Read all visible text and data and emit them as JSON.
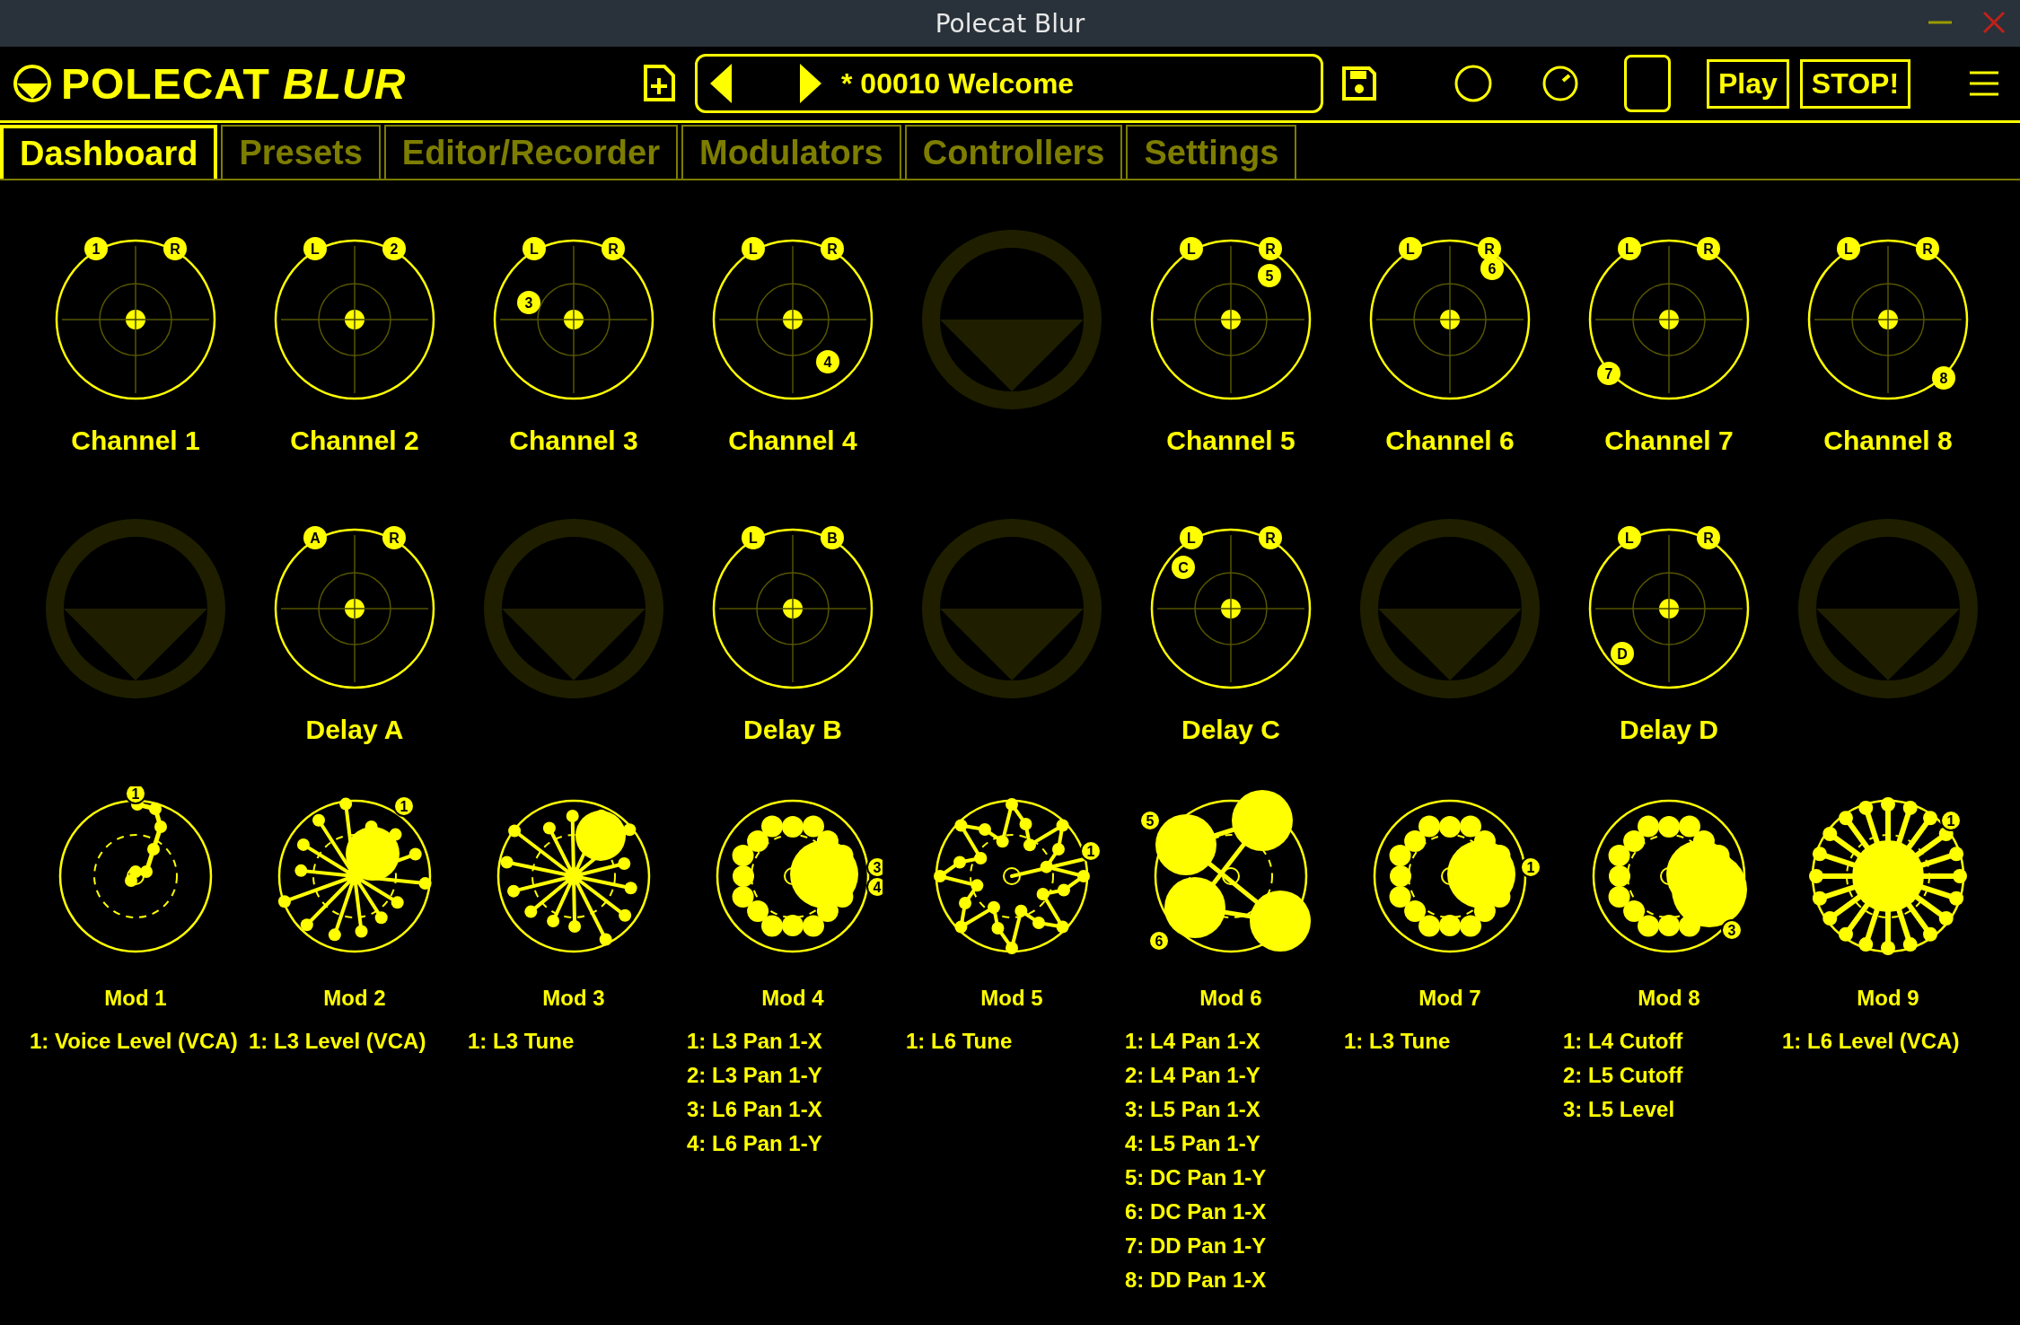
{
  "window": {
    "title": "Polecat Blur"
  },
  "toolbar": {
    "app_name": "POLECAT *BLUR*",
    "preset": "* 00010 Welcome",
    "buttons": [
      "Play",
      "STOP!"
    ]
  },
  "tabs": [
    {
      "label": "Dashboard",
      "selected": true
    },
    {
      "label": "Presets",
      "selected": false
    },
    {
      "label": "Editor/Recorder",
      "selected": false
    },
    {
      "label": "Modulators",
      "selected": false
    },
    {
      "label": "Controllers",
      "selected": false
    },
    {
      "label": "Settings",
      "selected": false
    }
  ],
  "pads": [
    {
      "kind": "pad",
      "label": "Channel 1",
      "markers": [
        "1",
        "R"
      ]
    },
    {
      "kind": "pad",
      "label": "Channel 2",
      "markers": [
        "L",
        "2"
      ]
    },
    {
      "kind": "pad",
      "label": "Channel 3",
      "markers": [
        "L",
        "R",
        "3"
      ]
    },
    {
      "kind": "pad",
      "label": "Channel 4",
      "markers": [
        "L",
        "R",
        "4"
      ]
    },
    {
      "kind": "empty"
    },
    {
      "kind": "pad",
      "label": "Channel 5",
      "markers": [
        "L",
        "R",
        "5"
      ]
    },
    {
      "kind": "pad",
      "label": "Channel 6",
      "markers": [
        "L",
        "R",
        "6"
      ]
    },
    {
      "kind": "pad",
      "label": "Channel 7",
      "markers": [
        "L",
        "R",
        "7"
      ]
    },
    {
      "kind": "pad",
      "label": "Channel 8",
      "markers": [
        "L",
        "R",
        "8"
      ]
    },
    {
      "kind": "empty"
    },
    {
      "kind": "pad",
      "label": "Delay A",
      "markers": [
        "A",
        "R"
      ]
    },
    {
      "kind": "empty"
    },
    {
      "kind": "pad",
      "label": "Delay B",
      "markers": [
        "L",
        "B"
      ]
    },
    {
      "kind": "empty"
    },
    {
      "kind": "pad",
      "label": "Delay C",
      "markers": [
        "L",
        "R",
        "C"
      ]
    },
    {
      "kind": "empty"
    },
    {
      "kind": "pad",
      "label": "Delay D",
      "markers": [
        "L",
        "R",
        "D"
      ]
    },
    {
      "kind": "empty"
    }
  ],
  "mods": [
    {
      "label": "Mod 1",
      "markers": [
        "1"
      ],
      "targets": [
        "1: Voice Level (VCA)"
      ]
    },
    {
      "label": "Mod 2",
      "markers": [
        "1"
      ],
      "targets": [
        "1: L3 Level (VCA)"
      ]
    },
    {
      "label": "Mod 3",
      "targets": [
        "1: L3 Tune"
      ]
    },
    {
      "label": "Mod 4",
      "markers": [
        "3",
        "4"
      ],
      "targets": [
        "1: L3 Pan 1-X",
        "2: L3 Pan 1-Y",
        "3: L6 Pan 1-X",
        "4: L6 Pan 1-Y"
      ]
    },
    {
      "label": "Mod 5",
      "markers": [
        "1"
      ],
      "targets": [
        "1: L6 Tune"
      ]
    },
    {
      "label": "Mod 6",
      "markers": [
        "5",
        "6"
      ],
      "targets": [
        "1: L4 Pan 1-X",
        "2: L4 Pan 1-Y",
        "3: L5 Pan 1-X",
        "4: L5 Pan 1-Y",
        "5: DC Pan 1-Y",
        "6: DC Pan 1-X",
        "7: DD Pan 1-Y",
        "8: DD Pan 1-X"
      ]
    },
    {
      "label": "Mod 7",
      "markers": [
        "1"
      ],
      "targets": [
        "1: L3 Tune"
      ]
    },
    {
      "label": "Mod 8",
      "markers": [
        "3"
      ],
      "targets": [
        "1: L4 Cutoff",
        "2: L5 Cutoff",
        "3: L5 Level"
      ]
    },
    {
      "label": "Mod 9",
      "markers": [
        "1"
      ],
      "targets": [
        "1: L6 Level (VCA)"
      ]
    }
  ]
}
